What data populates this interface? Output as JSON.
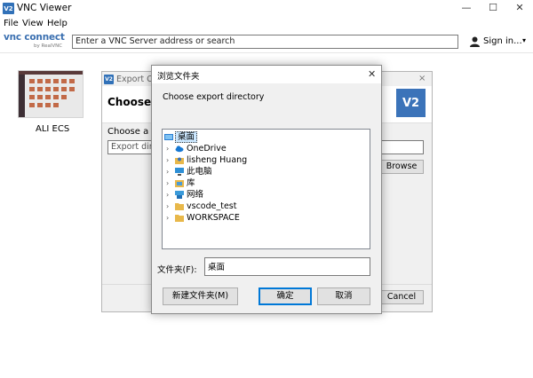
{
  "app": {
    "title": "VNC Viewer",
    "logo_text": "V2",
    "menu": [
      "File",
      "View",
      "Help"
    ],
    "window_controls": {
      "minimize": "—",
      "maximize": "☐",
      "close": "✕"
    }
  },
  "toolbar": {
    "brand": "vnc connect",
    "brand_sub": "by RealVNC",
    "address_placeholder": "Enter a VNC Server address or search",
    "signin_label": "Sign in...",
    "signin_caret": "▾"
  },
  "connections": [
    {
      "label": "ALI ECS"
    }
  ],
  "export_dialog": {
    "title": "Export Co",
    "heading": "Choose ex",
    "choose_label": "Choose a d",
    "field_value": "Export dire",
    "browse_label": "Browse",
    "cancel_label": "Cancel",
    "logo_text": "V2",
    "close_glyph": "×"
  },
  "browse_dialog": {
    "title": "浏览文件夹",
    "close_glyph": "✕",
    "prompt": "Choose export directory",
    "tree": [
      {
        "label": "桌面",
        "icon": "desktop-folder-icon",
        "expandable": false,
        "selected": true,
        "level": 0
      },
      {
        "label": "OneDrive",
        "icon": "cloud-icon",
        "expandable": true,
        "selected": false,
        "level": 1
      },
      {
        "label": "lisheng Huang",
        "icon": "user-folder-icon",
        "expandable": true,
        "selected": false,
        "level": 1
      },
      {
        "label": "此电脑",
        "icon": "computer-icon",
        "expandable": true,
        "selected": false,
        "level": 1
      },
      {
        "label": "库",
        "icon": "library-icon",
        "expandable": true,
        "selected": false,
        "level": 1
      },
      {
        "label": "网络",
        "icon": "network-icon",
        "expandable": true,
        "selected": false,
        "level": 1
      },
      {
        "label": "vscode_test",
        "icon": "folder-icon",
        "expandable": true,
        "selected": false,
        "level": 1
      },
      {
        "label": "WORKSPACE",
        "icon": "folder-icon",
        "expandable": true,
        "selected": false,
        "level": 1
      }
    ],
    "folder_label": "文件夹(F):",
    "folder_value": "桌面",
    "new_folder_label": "新建文件夹(M)",
    "ok_label": "确定",
    "cancel_label": "取消"
  },
  "colors": {
    "accent": "#3171b8",
    "selection": "#cce8ff",
    "folder": "#e8b84a"
  }
}
